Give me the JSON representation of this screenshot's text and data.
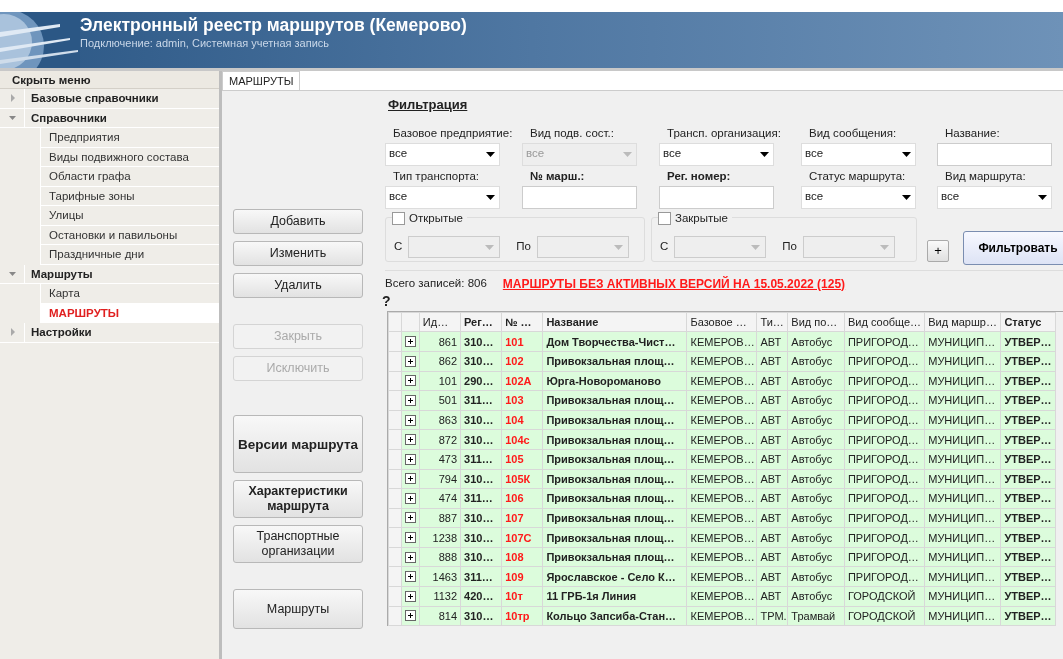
{
  "header": {
    "title": "Электронный реестр маршрутов (Кемерово)",
    "subtitle": "Подключение: admin, Системная учетная запись"
  },
  "sidebar": {
    "hide_label": "Скрыть меню",
    "items": [
      {
        "label": "Базовые справочники",
        "expanded": false,
        "selected": false
      },
      {
        "label": "Справочники",
        "expanded": true,
        "selected": false,
        "children": [
          {
            "label": "Предприятия",
            "selected": false
          },
          {
            "label": "Виды подвижного состава",
            "selected": false
          },
          {
            "label": "Области графа",
            "selected": false
          },
          {
            "label": "Тарифные зоны",
            "selected": false
          },
          {
            "label": "Улицы",
            "selected": false
          },
          {
            "label": "Остановки и павильоны",
            "selected": false
          },
          {
            "label": "Праздничные дни",
            "selected": false
          }
        ]
      },
      {
        "label": "Маршруты",
        "expanded": true,
        "selected": false,
        "children": [
          {
            "label": "Карта",
            "selected": false
          },
          {
            "label": "МАРШРУТЫ",
            "selected": true
          }
        ]
      },
      {
        "label": "Настройки",
        "expanded": false,
        "selected": false
      }
    ]
  },
  "tabs": [
    {
      "label": "МАРШРУТЫ",
      "selected": true
    }
  ],
  "button_groups": [
    [
      {
        "label": "Добавить",
        "disabled": false,
        "bold": false,
        "kind": "normal"
      },
      {
        "label": "Изменить",
        "disabled": false,
        "bold": false,
        "kind": "normal"
      },
      {
        "label": "Удалить",
        "disabled": false,
        "bold": false,
        "kind": "normal"
      }
    ],
    [
      {
        "label": "Закрыть",
        "disabled": true,
        "bold": false,
        "kind": "normal"
      },
      {
        "label": "Исключить",
        "disabled": true,
        "bold": false,
        "kind": "normal"
      }
    ],
    [
      {
        "label": "Версии маршрута",
        "disabled": false,
        "bold": true,
        "kind": "tall"
      },
      {
        "label": "Характеристики маршрута",
        "disabled": false,
        "bold": true,
        "kind": "double"
      },
      {
        "label": "Транспортные организации",
        "disabled": false,
        "bold": false,
        "kind": "double"
      }
    ],
    [
      {
        "label": "Маршруты",
        "disabled": false,
        "bold": false,
        "kind": "medium"
      }
    ]
  ],
  "filter": {
    "title": "Фильтрация",
    "fields": [
      {
        "label": "Базовое предприятие:",
        "kind": "select",
        "value": "все",
        "disabled": false,
        "bold": false
      },
      {
        "label": "Вид подв. сост.:",
        "kind": "select",
        "value": "все",
        "disabled": true,
        "bold": false
      },
      {
        "label": "Трансп. организация:",
        "kind": "select",
        "value": "все",
        "disabled": false,
        "bold": false
      },
      {
        "label": "Вид сообщения:",
        "kind": "select",
        "value": "все",
        "disabled": false,
        "bold": false
      },
      {
        "label": "Название:",
        "kind": "text",
        "disabled": false,
        "bold": false
      },
      {
        "label": "Тип транспорта:",
        "kind": "select",
        "value": "все",
        "disabled": false,
        "bold": false
      },
      {
        "label": "№ марш.:",
        "kind": "text",
        "disabled": false,
        "bold": true
      },
      {
        "label": "Рег. номер:",
        "kind": "text",
        "disabled": false,
        "bold": true
      },
      {
        "label": "Статус маршрута:",
        "kind": "select",
        "value": "все",
        "disabled": false,
        "bold": false
      },
      {
        "label": "Вид маршрута:",
        "kind": "select",
        "value": "все",
        "disabled": false,
        "bold": false
      }
    ],
    "periods": [
      {
        "label": "Открытые",
        "checked": false,
        "from_label": "С",
        "to_label": "По"
      },
      {
        "label": "Закрытые",
        "checked": false,
        "from_label": "С",
        "to_label": "По"
      }
    ],
    "add_button": "+",
    "apply_button": "Фильтровать"
  },
  "total": "Всего записей: 806",
  "alert_link": "МАРШРУТЫ БЕЗ АКТИВНЫХ ВЕРСИЙ НА 15.05.2022 (125)",
  "table": {
    "corner": "?",
    "columns": [
      "Ид…",
      "Рег…",
      "№ …",
      "Название",
      "Базовое …",
      "Ти…",
      "Вид по…",
      "Вид сообще…",
      "Вид маршр…",
      "Статус"
    ],
    "rows": [
      {
        "expanded": false,
        "cells": [
          "861",
          "310…",
          "101",
          "Дом Творчества-Чист…",
          "КЕМЕРОВ…",
          "АВТ",
          "Автобус",
          "ПРИГОРОД…",
          "МУНИЦИП…",
          "УТВЕР…"
        ]
      },
      {
        "expanded": false,
        "cells": [
          "862",
          "310…",
          "102",
          "Привокзальная площ…",
          "КЕМЕРОВ…",
          "АВТ",
          "Автобус",
          "ПРИГОРОД…",
          "МУНИЦИП…",
          "УТВЕР…"
        ]
      },
      {
        "expanded": false,
        "cells": [
          "101",
          "290…",
          "102А",
          "Юрга-Новороманово",
          "КЕМЕРОВ…",
          "АВТ",
          "Автобус",
          "ПРИГОРОД…",
          "МУНИЦИП…",
          "УТВЕР…"
        ]
      },
      {
        "expanded": false,
        "cells": [
          "501",
          "311…",
          "103",
          "Привокзальная площ…",
          "КЕМЕРОВ…",
          "АВТ",
          "Автобус",
          "ПРИГОРОД…",
          "МУНИЦИП…",
          "УТВЕР…"
        ]
      },
      {
        "expanded": false,
        "cells": [
          "863",
          "310…",
          "104",
          "Привокзальная площ…",
          "КЕМЕРОВ…",
          "АВТ",
          "Автобус",
          "ПРИГОРОД…",
          "МУНИЦИП…",
          "УТВЕР…"
        ]
      },
      {
        "expanded": false,
        "cells": [
          "872",
          "310…",
          "104с",
          "Привокзальная площ…",
          "КЕМЕРОВ…",
          "АВТ",
          "Автобус",
          "ПРИГОРОД…",
          "МУНИЦИП…",
          "УТВЕР…"
        ]
      },
      {
        "expanded": false,
        "cells": [
          "473",
          "311…",
          "105",
          "Привокзальная площ…",
          "КЕМЕРОВ…",
          "АВТ",
          "Автобус",
          "ПРИГОРОД…",
          "МУНИЦИП…",
          "УТВЕР…"
        ]
      },
      {
        "expanded": false,
        "cells": [
          "794",
          "310…",
          "105К",
          "Привокзальная площ…",
          "КЕМЕРОВ…",
          "АВТ",
          "Автобус",
          "ПРИГОРОД…",
          "МУНИЦИП…",
          "УТВЕР…"
        ]
      },
      {
        "expanded": false,
        "cells": [
          "474",
          "311…",
          "106",
          "Привокзальная площ…",
          "КЕМЕРОВ…",
          "АВТ",
          "Автобус",
          "ПРИГОРОД…",
          "МУНИЦИП…",
          "УТВЕР…"
        ]
      },
      {
        "expanded": false,
        "cells": [
          "887",
          "310…",
          "107",
          "Привокзальная площ…",
          "КЕМЕРОВ…",
          "АВТ",
          "Автобус",
          "ПРИГОРОД…",
          "МУНИЦИП…",
          "УТВЕР…"
        ]
      },
      {
        "expanded": false,
        "cells": [
          "1238",
          "310…",
          "107С",
          "Привокзальная площ…",
          "КЕМЕРОВ…",
          "АВТ",
          "Автобус",
          "ПРИГОРОД…",
          "МУНИЦИП…",
          "УТВЕР…"
        ]
      },
      {
        "expanded": false,
        "cells": [
          "888",
          "310…",
          "108",
          "Привокзальная площ…",
          "КЕМЕРОВ…",
          "АВТ",
          "Автобус",
          "ПРИГОРОД…",
          "МУНИЦИП…",
          "УТВЕР…"
        ]
      },
      {
        "expanded": false,
        "cells": [
          "1463",
          "311…",
          "109",
          "Ярославское - Село К…",
          "КЕМЕРОВ…",
          "АВТ",
          "Автобус",
          "ПРИГОРОД…",
          "МУНИЦИП…",
          "УТВЕР…"
        ]
      },
      {
        "expanded": false,
        "cells": [
          "1132",
          "420…",
          "10т",
          "11 ГРБ-1я Линия",
          "КЕМЕРОВ…",
          "АВТ",
          "Автобус",
          "ГОРОДСКОЙ",
          "МУНИЦИП…",
          "УТВЕР…"
        ]
      },
      {
        "expanded": false,
        "cells": [
          "814",
          "310…",
          "10тр",
          "Кольцо Запсиба-Стан…",
          "КЕМЕРОВ…",
          "ТРМ.",
          "Трамвай",
          "ГОРОДСКОЙ",
          "МУНИЦИП…",
          "УТВЕР…"
        ]
      }
    ]
  }
}
